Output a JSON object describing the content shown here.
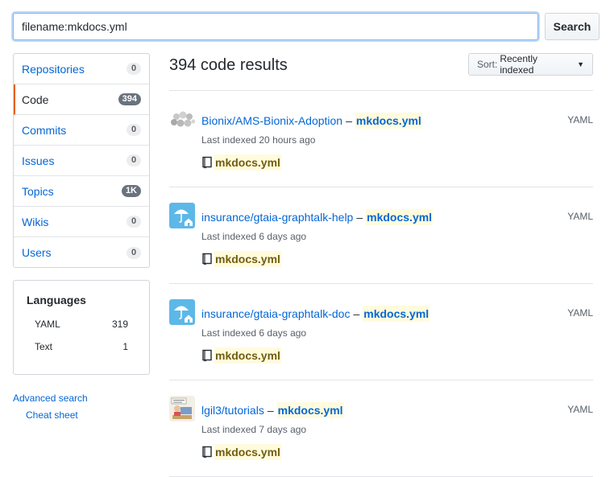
{
  "search": {
    "value": "filename:mkdocs.yml",
    "button_label": "Search"
  },
  "menu": {
    "items": [
      {
        "label": "Repositories",
        "count": "0"
      },
      {
        "label": "Code",
        "count": "394"
      },
      {
        "label": "Commits",
        "count": "0"
      },
      {
        "label": "Issues",
        "count": "0"
      },
      {
        "label": "Topics",
        "count": "1K"
      },
      {
        "label": "Wikis",
        "count": "0"
      },
      {
        "label": "Users",
        "count": "0"
      }
    ]
  },
  "languages": {
    "title": "Languages",
    "items": [
      {
        "name": "YAML",
        "count": "319"
      },
      {
        "name": "Text",
        "count": "1"
      }
    ]
  },
  "links": {
    "advanced_search": "Advanced search",
    "cheat_sheet": "Cheat sheet"
  },
  "results": {
    "title": "394 code results",
    "sort_prefix": "Sort:",
    "sort_value": "Recently indexed",
    "items": [
      {
        "repo": "Bionix/AMS-Bionix-Adoption",
        "file": "mkdocs.yml",
        "indexed": "Last indexed 20 hours ago",
        "language": "YAML",
        "filename": "mkdocs.yml",
        "avatar": "bionix-avatar-icon"
      },
      {
        "repo": "insurance/gtaia-graphtalk-help",
        "file": "mkdocs.yml",
        "indexed": "Last indexed 6 days ago",
        "language": "YAML",
        "filename": "mkdocs.yml",
        "avatar": "umbrella-house-avatar-icon"
      },
      {
        "repo": "insurance/gtaia-graphtalk-doc",
        "file": "mkdocs.yml",
        "indexed": "Last indexed 6 days ago",
        "language": "YAML",
        "filename": "mkdocs.yml",
        "avatar": "umbrella-house-avatar-icon"
      },
      {
        "repo": "lgil3/tutorials",
        "file": "mkdocs.yml",
        "indexed": "Last indexed 7 days ago",
        "language": "YAML",
        "filename": "mkdocs.yml",
        "avatar": "cartoon-avatar-icon"
      }
    ]
  },
  "colors": {
    "link": "#0366d6",
    "highlight": "#fffbdd",
    "selected_border": "#e36209"
  }
}
